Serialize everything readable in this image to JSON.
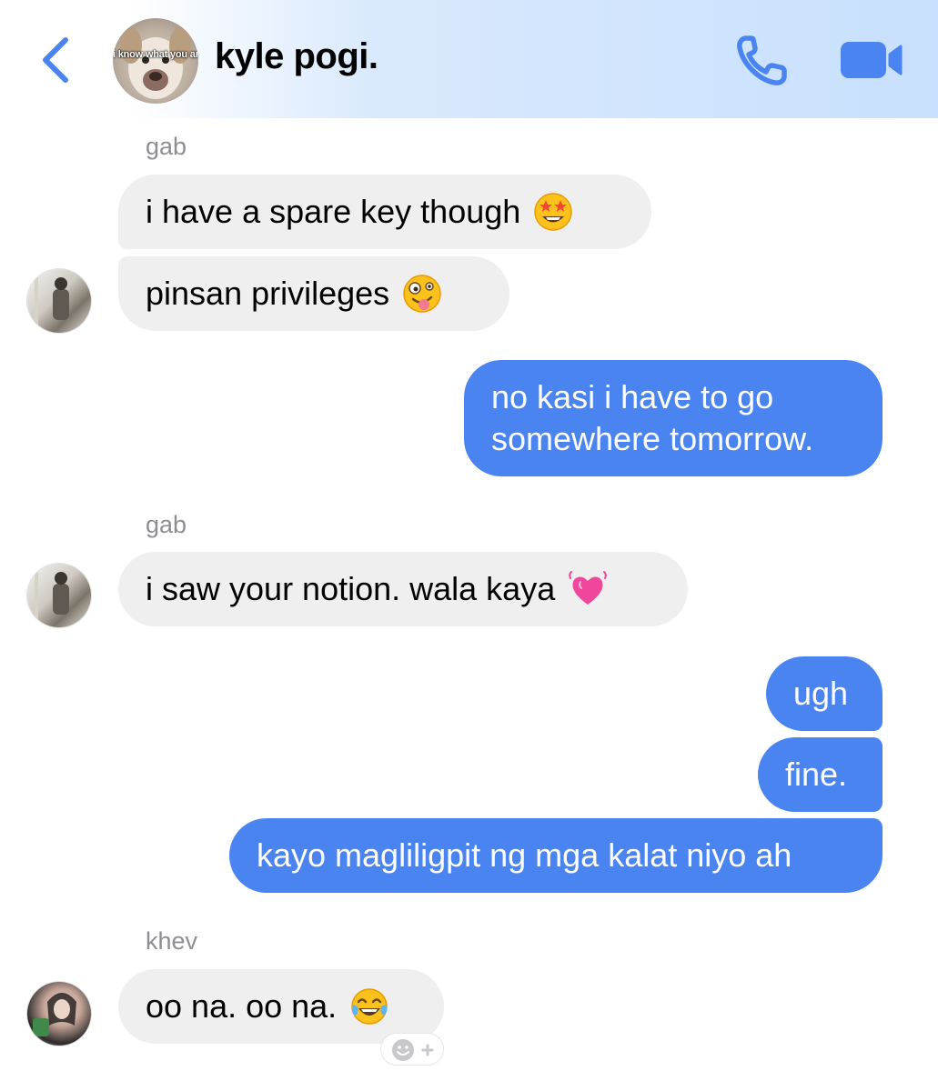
{
  "header": {
    "title": "kyle pogi.",
    "avatar_caption": "i know what you are",
    "accent": "#4a84f0"
  },
  "messages": {
    "m1_sender": "gab",
    "m1": "i have a spare key though",
    "m2": "pinsan privileges",
    "m3_line1": "no kasi i have to go",
    "m3_line2": "somewhere tomorrow.",
    "m4_sender": "gab",
    "m4": "i saw your notion. wala kaya",
    "m5": "ugh",
    "m6": "fine.",
    "m7": "kayo magliligpit ng mga kalat niyo ah",
    "m8_sender": "khev",
    "m8": "oo na. oo na."
  },
  "icons": {
    "back": "chevron-left-icon",
    "call": "phone-icon",
    "video": "video-camera-icon",
    "star_struck": "star-struck-emoji",
    "zany": "zany-face-emoji",
    "heart": "growing-heart-emoji",
    "laugh": "tears-of-joy-emoji",
    "react": "add-reaction-icon"
  },
  "colors": {
    "incoming_bubble": "#efefef",
    "outgoing_bubble": "#4a84f0",
    "sender_name": "#8e8e93"
  }
}
